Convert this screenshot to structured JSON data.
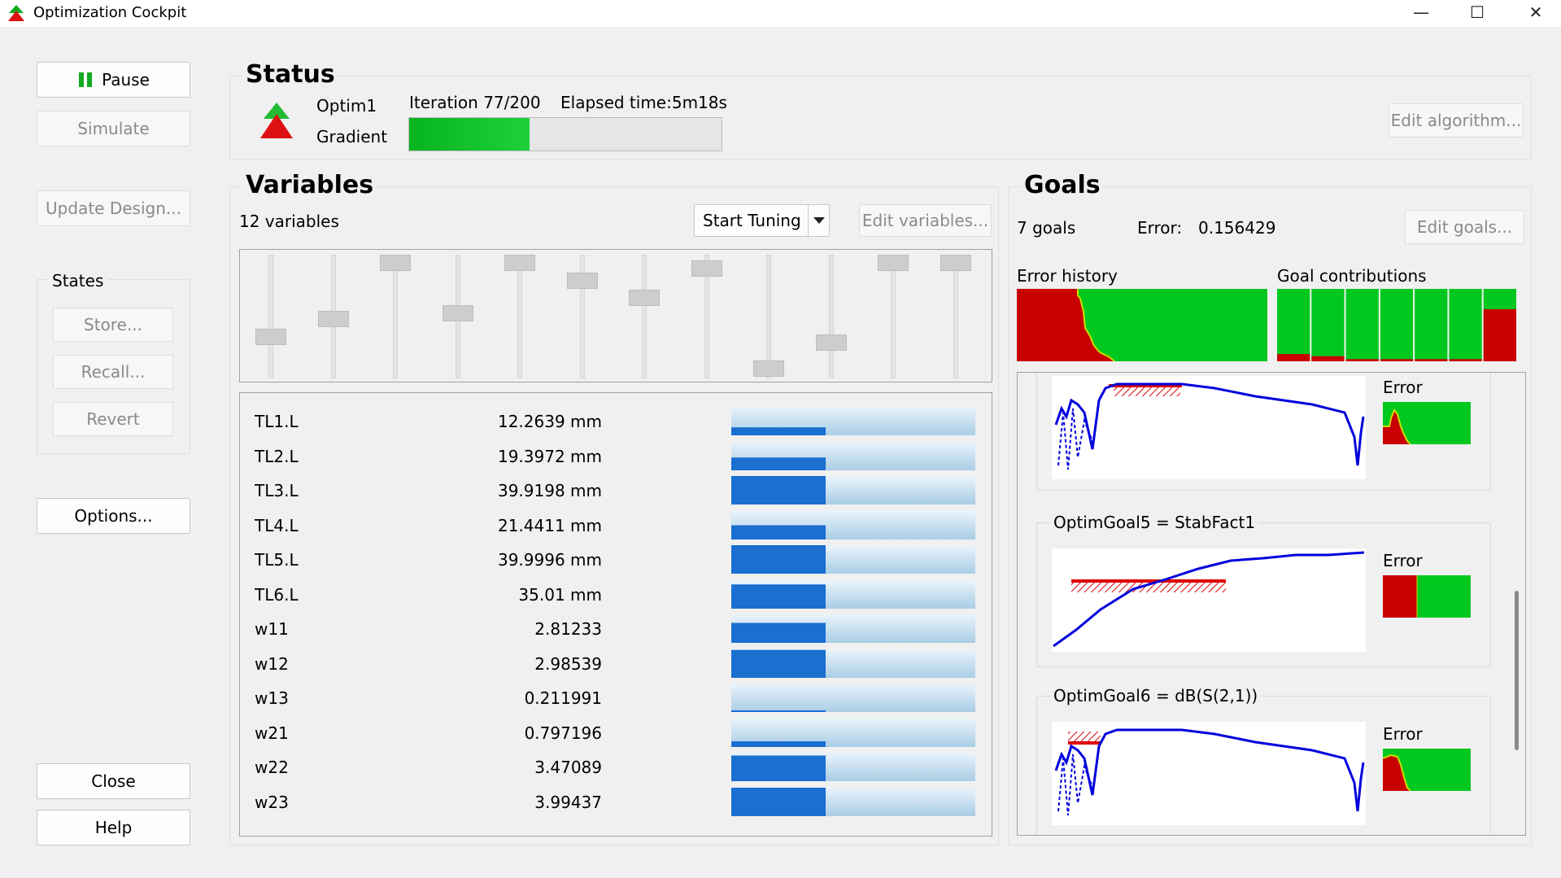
{
  "window": {
    "title": "Optimization Cockpit",
    "minimize": "—",
    "maximize": "☐",
    "close": "✕"
  },
  "left": {
    "pause": "Pause",
    "simulate": "Simulate",
    "update_design": "Update Design...",
    "states_title": "States",
    "store": "Store...",
    "recall": "Recall...",
    "revert": "Revert",
    "options": "Options...",
    "close": "Close",
    "help": "Help"
  },
  "status": {
    "title": "Status",
    "name": "Optim1",
    "algorithm": "Gradient",
    "iteration": "Iteration 77/200",
    "elapsed": "Elapsed time:5m18s",
    "progress": 0.385,
    "edit_algorithm": "Edit algorithm..."
  },
  "variables": {
    "title": "Variables",
    "count": "12 variables",
    "start_tuning": "Start Tuning",
    "edit_variables": "Edit variables...",
    "slider_levels": [
      0.3,
      0.47,
      1.0,
      0.52,
      1.0,
      0.83,
      0.67,
      0.95,
      0.0,
      0.25,
      1.0,
      1.0
    ],
    "items": [
      {
        "name": "TL1.L",
        "value": "12.2639 mm",
        "level": 0.28
      },
      {
        "name": "TL2.L",
        "value": "19.3972 mm",
        "level": 0.45
      },
      {
        "name": "TL3.L",
        "value": "39.9198 mm",
        "level": 1.0
      },
      {
        "name": "TL4.L",
        "value": "21.4411 mm",
        "level": 0.5
      },
      {
        "name": "TL5.L",
        "value": "39.9996 mm",
        "level": 1.0
      },
      {
        "name": "TL6.L",
        "value": "35.01 mm",
        "level": 0.85
      },
      {
        "name": "w11",
        "value": "2.81233",
        "level": 0.7
      },
      {
        "name": "w12",
        "value": "2.98539",
        "level": 0.98
      },
      {
        "name": "w13",
        "value": "0.211991",
        "level": 0.05
      },
      {
        "name": "w21",
        "value": "0.797196",
        "level": 0.2
      },
      {
        "name": "w22",
        "value": "3.47089",
        "level": 0.9
      },
      {
        "name": "w23",
        "value": "3.99437",
        "level": 1.0
      }
    ]
  },
  "goals": {
    "title": "Goals",
    "count": "7 goals",
    "error_label": "Error:",
    "error_value": "0.156429",
    "edit_goals": "Edit goals...",
    "error_history": "Error history",
    "goal_contributions": "Goal contributions",
    "contributions": [
      0.1,
      0.07,
      0.03,
      0.03,
      0.03,
      0.03,
      0.72
    ],
    "items": [
      {
        "label": "",
        "error_label": "Error"
      },
      {
        "label": "OptimGoal5 = StabFact1",
        "error_label": "Error"
      },
      {
        "label": "OptimGoal6 = dB(S(2,1))",
        "error_label": "Error"
      }
    ]
  },
  "colors": {
    "green": "#00cc22",
    "red": "#cc0000",
    "blue": "#0000dd",
    "accent_blue": "#1a6fd0"
  }
}
